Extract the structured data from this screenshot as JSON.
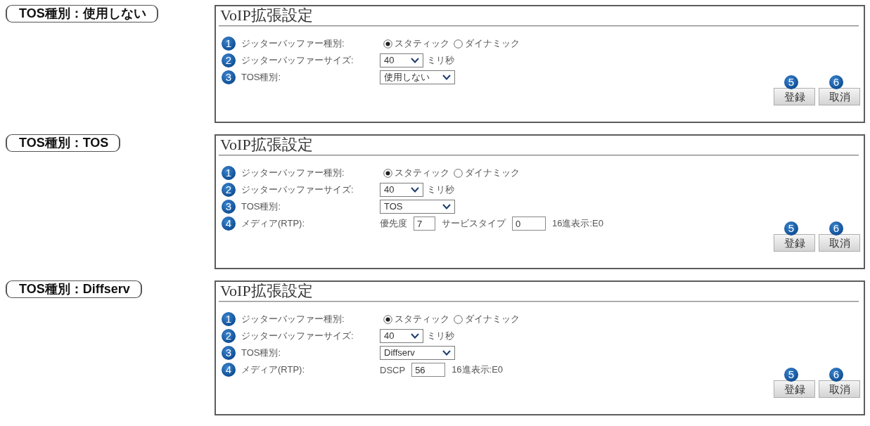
{
  "sections": [
    {
      "caption": "TOS種別：使用しない",
      "title": "VoIP拡張設定",
      "rows": [
        {
          "number": "1",
          "label": "ジッターバッファー種別:",
          "kind": "radio",
          "options": [
            {
              "label": "スタティック",
              "selected": true
            },
            {
              "label": "ダイナミック",
              "selected": false
            }
          ]
        },
        {
          "number": "2",
          "label": "ジッターバッファーサイズ:",
          "kind": "duration",
          "value": "40",
          "unit": "ミリ秒"
        },
        {
          "number": "3",
          "label": "TOS種別:",
          "kind": "select",
          "value": "使用しない"
        }
      ],
      "buttons": [
        {
          "number": "5",
          "label": "登録"
        },
        {
          "number": "6",
          "label": "取消"
        }
      ]
    },
    {
      "caption": "TOS種別：TOS",
      "title": "VoIP拡張設定",
      "rows": [
        {
          "number": "1",
          "label": "ジッターバッファー種別:",
          "kind": "radio",
          "options": [
            {
              "label": "スタティック",
              "selected": true
            },
            {
              "label": "ダイナミック",
              "selected": false
            }
          ]
        },
        {
          "number": "2",
          "label": "ジッターバッファーサイズ:",
          "kind": "duration",
          "value": "40",
          "unit": "ミリ秒"
        },
        {
          "number": "3",
          "label": "TOS種別:",
          "kind": "select",
          "value": "TOS"
        },
        {
          "number": "4",
          "label": "メディア(RTP):",
          "kind": "fields",
          "parts": [
            {
              "kind": "text",
              "text": "優先度"
            },
            {
              "kind": "digit",
              "value": "7"
            },
            {
              "kind": "text",
              "text": "サービスタイプ"
            },
            {
              "kind": "field",
              "value": "0"
            },
            {
              "kind": "text",
              "text": "16進表示:E0"
            }
          ]
        }
      ],
      "buttons": [
        {
          "number": "5",
          "label": "登録"
        },
        {
          "number": "6",
          "label": "取消"
        }
      ]
    },
    {
      "caption": "TOS種別：Diffserv",
      "title": "VoIP拡張設定",
      "rows": [
        {
          "number": "1",
          "label": "ジッターバッファー種別:",
          "kind": "radio",
          "options": [
            {
              "label": "スタティック",
              "selected": true
            },
            {
              "label": "ダイナミック",
              "selected": false
            }
          ]
        },
        {
          "number": "2",
          "label": "ジッターバッファーサイズ:",
          "kind": "duration",
          "value": "40",
          "unit": "ミリ秒"
        },
        {
          "number": "3",
          "label": "TOS種別:",
          "kind": "select",
          "value": "Diffserv"
        },
        {
          "number": "4",
          "label": "メディア(RTP):",
          "kind": "fields",
          "parts": [
            {
              "kind": "text",
              "text": "DSCP"
            },
            {
              "kind": "field",
              "value": "56"
            },
            {
              "kind": "text",
              "text": "16進表示:E0"
            }
          ]
        }
      ],
      "buttons": [
        {
          "number": "5",
          "label": "登録"
        },
        {
          "number": "6",
          "label": "取消"
        }
      ]
    }
  ]
}
